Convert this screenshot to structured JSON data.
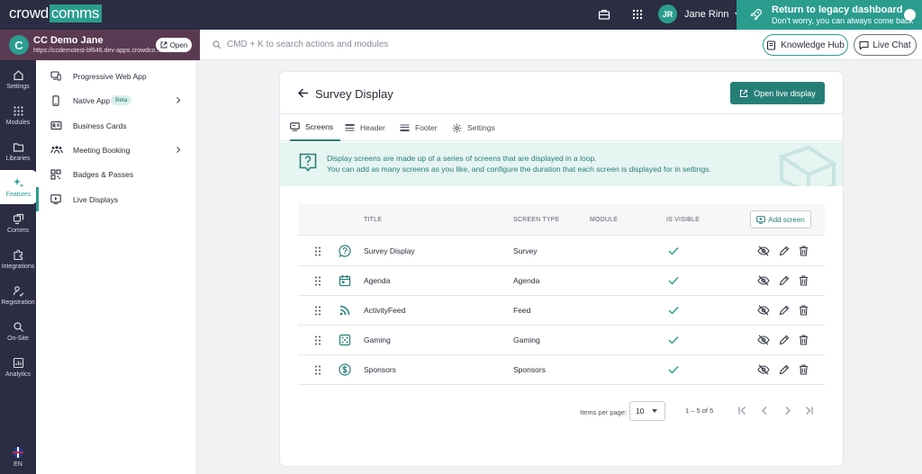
{
  "topbar": {
    "logo_pre": "crowd",
    "logo_post": "comms",
    "user_initials": "JR",
    "user_name": "Jane Rinn",
    "legacy_title": "Return to legacy dashboard",
    "legacy_sub": "Don't worry, you can always come back"
  },
  "event": {
    "name": "CC Demo Jane",
    "url": "https://ccdemotest-bf646.dev-apps.crowdco...",
    "open_label": "Open",
    "logo_letter": "C"
  },
  "search": {
    "placeholder": "CMD + K to search actions and modules"
  },
  "header_buttons": {
    "knowledge_hub": "Knowledge Hub",
    "live_chat": "Live Chat"
  },
  "rail": {
    "items": [
      {
        "label": "Settings",
        "icon": "home-icon"
      },
      {
        "label": "Modules",
        "icon": "grid-icon"
      },
      {
        "label": "Libraries",
        "icon": "folder-icon"
      },
      {
        "label": "Features",
        "icon": "sparkle-icon"
      },
      {
        "label": "Comms",
        "icon": "comms-icon"
      },
      {
        "label": "Integrations",
        "icon": "puzzle-icon"
      },
      {
        "label": "Registration",
        "icon": "registration-icon"
      },
      {
        "label": "On-Site",
        "icon": "onsite-icon"
      },
      {
        "label": "Analytics",
        "icon": "analytics-icon"
      }
    ],
    "active": "Features",
    "language": "EN"
  },
  "submenu": {
    "items": [
      {
        "label": "Progressive Web App"
      },
      {
        "label": "Native App",
        "badge": "Beta"
      },
      {
        "label": "Business Cards"
      },
      {
        "label": "Meeting Booking"
      },
      {
        "label": "Badges & Passes"
      },
      {
        "label": "Live Displays"
      }
    ],
    "active": "Live Displays"
  },
  "page": {
    "title": "Survey Display",
    "open_live_label": "Open live display",
    "tabs": [
      "Screens",
      "Header",
      "Footer",
      "Settings"
    ],
    "active_tab": "Screens",
    "info_line1": "Display screens are made up of a series of screens that are displayed in a loop.",
    "info_line2": "You can add as many screens as you like, and configure the duration that each screen is displayed for in settings."
  },
  "table": {
    "columns": [
      "TITLE",
      "SCREEN TYPE",
      "MODULE",
      "IS VISIBLE"
    ],
    "add_label": "Add screen",
    "rows": [
      {
        "title": "Survey Display",
        "type": "Survey",
        "module": "",
        "visible": true,
        "icon": "survey-icon"
      },
      {
        "title": "Agenda",
        "type": "Agenda",
        "module": "",
        "visible": true,
        "icon": "calendar-icon"
      },
      {
        "title": "ActivityFeed",
        "type": "Feed",
        "module": "",
        "visible": true,
        "icon": "feed-icon"
      },
      {
        "title": "Gaming",
        "type": "Gaming",
        "module": "",
        "visible": true,
        "icon": "gaming-icon"
      },
      {
        "title": "Sponsors",
        "type": "Sponsors",
        "module": "",
        "visible": true,
        "icon": "dollar-icon"
      }
    ]
  },
  "pager": {
    "items_per_page_label": "Items per page:",
    "items_per_page": "10",
    "range": "1 – 5 of 5"
  },
  "colors": {
    "accent": "#2a9d8f",
    "accent_dark": "#267f77",
    "nav_bg": "#2b2d42",
    "event_bg": "#5a3a52"
  }
}
